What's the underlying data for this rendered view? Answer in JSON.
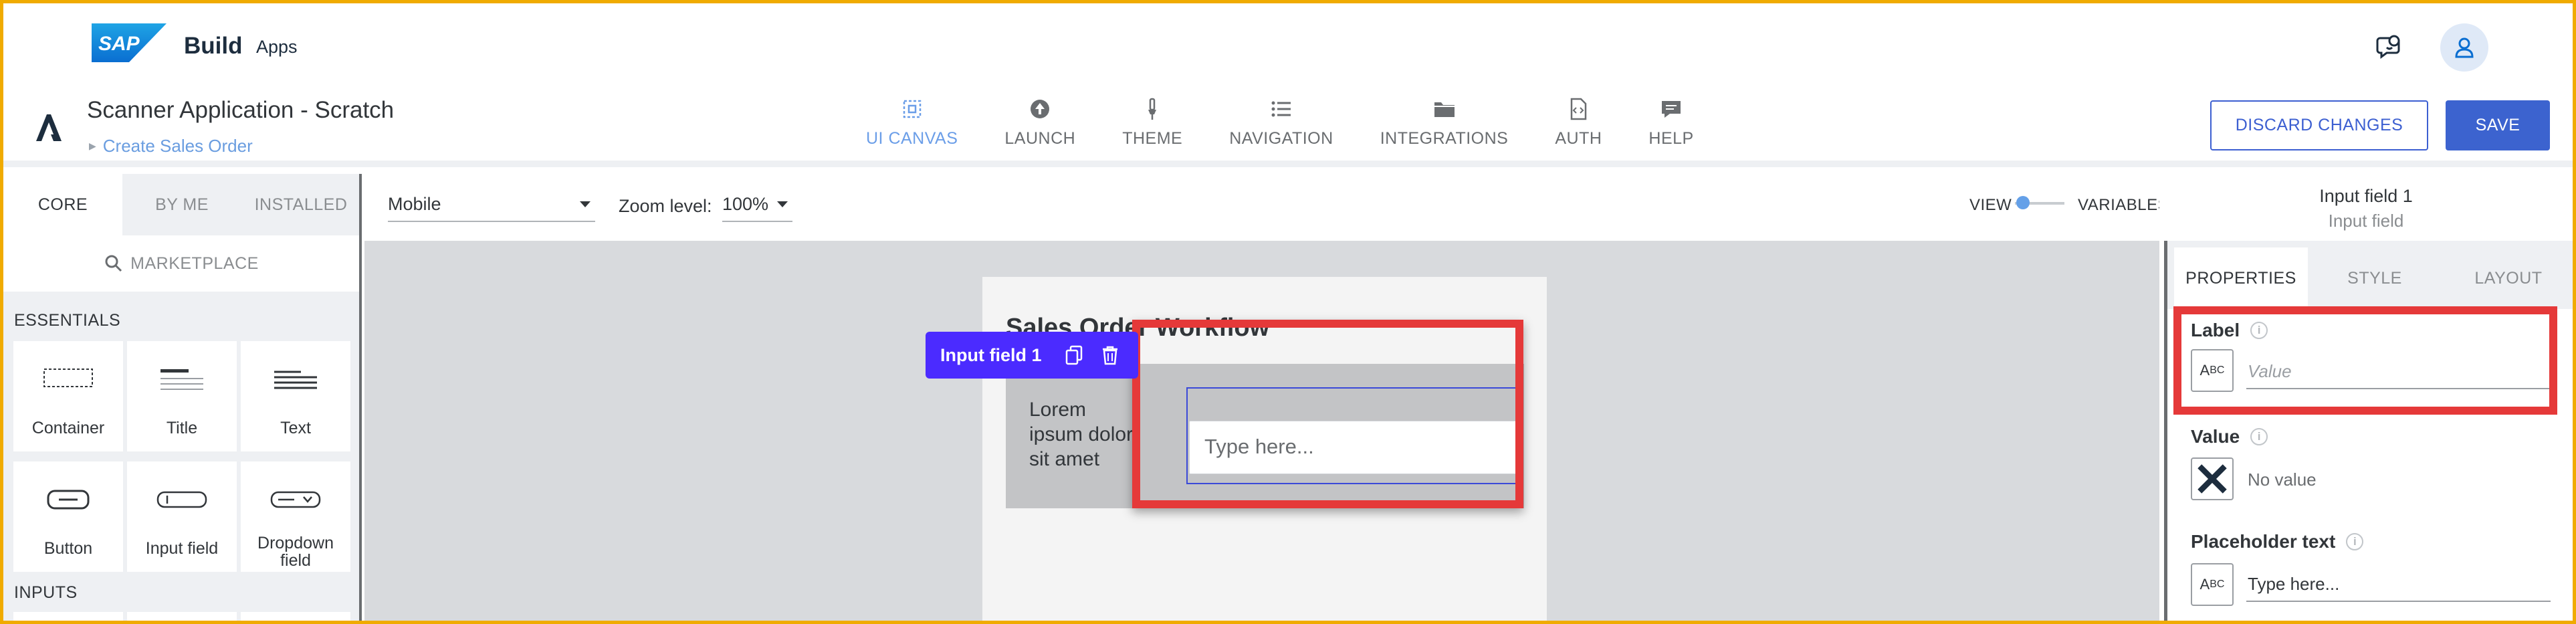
{
  "shell": {
    "logo": "SAP",
    "product": "Build",
    "product_sub": "Apps"
  },
  "app": {
    "title": "Scanner Application - Scratch",
    "breadcrumb": "Create Sales Order",
    "nav_tabs": [
      {
        "label": "UI CANVAS",
        "icon": "ui-canvas-icon",
        "active": true
      },
      {
        "label": "LAUNCH",
        "icon": "launch-icon"
      },
      {
        "label": "THEME",
        "icon": "theme-icon"
      },
      {
        "label": "NAVIGATION",
        "icon": "navigation-icon"
      },
      {
        "label": "INTEGRATIONS",
        "icon": "integrations-icon"
      },
      {
        "label": "AUTH",
        "icon": "auth-icon"
      },
      {
        "label": "HELP",
        "icon": "help-icon"
      }
    ],
    "discard_label": "DISCARD CHANGES",
    "save_label": "SAVE",
    "accent_color": "#3c63cf"
  },
  "left_panel": {
    "tabs": [
      "CORE",
      "BY ME",
      "INSTALLED"
    ],
    "marketplace": "MARKETPLACE",
    "section_essentials": "ESSENTIALS",
    "components": [
      "Container",
      "Title",
      "Text",
      "Button",
      "Input field",
      "Dropdown field"
    ],
    "section_inputs": "INPUTS"
  },
  "toolbar": {
    "device": "Mobile",
    "zoom_label": "Zoom level:",
    "zoom_value": "100%",
    "view_label": "VIEW",
    "variables_label": "VARIABLES"
  },
  "selection": {
    "name": "Input field 1",
    "type": "Input field"
  },
  "canvas": {
    "heading": "Sales Order Workflow",
    "lorem": "Lorem ipsum dolor sit amet",
    "input_placeholder": "Type here...",
    "floatbar_label": "Input field 1",
    "floatbar_color": "#4b2bff",
    "highlight_color": "#e53939"
  },
  "right_panel": {
    "tabs": [
      "PROPERTIES",
      "STYLE",
      "LAYOUT"
    ],
    "label_title": "Label",
    "label_placeholder": "Value",
    "value_title": "Value",
    "value_text": "No value",
    "placeholder_title": "Placeholder text",
    "placeholder_value": "Type here..."
  }
}
